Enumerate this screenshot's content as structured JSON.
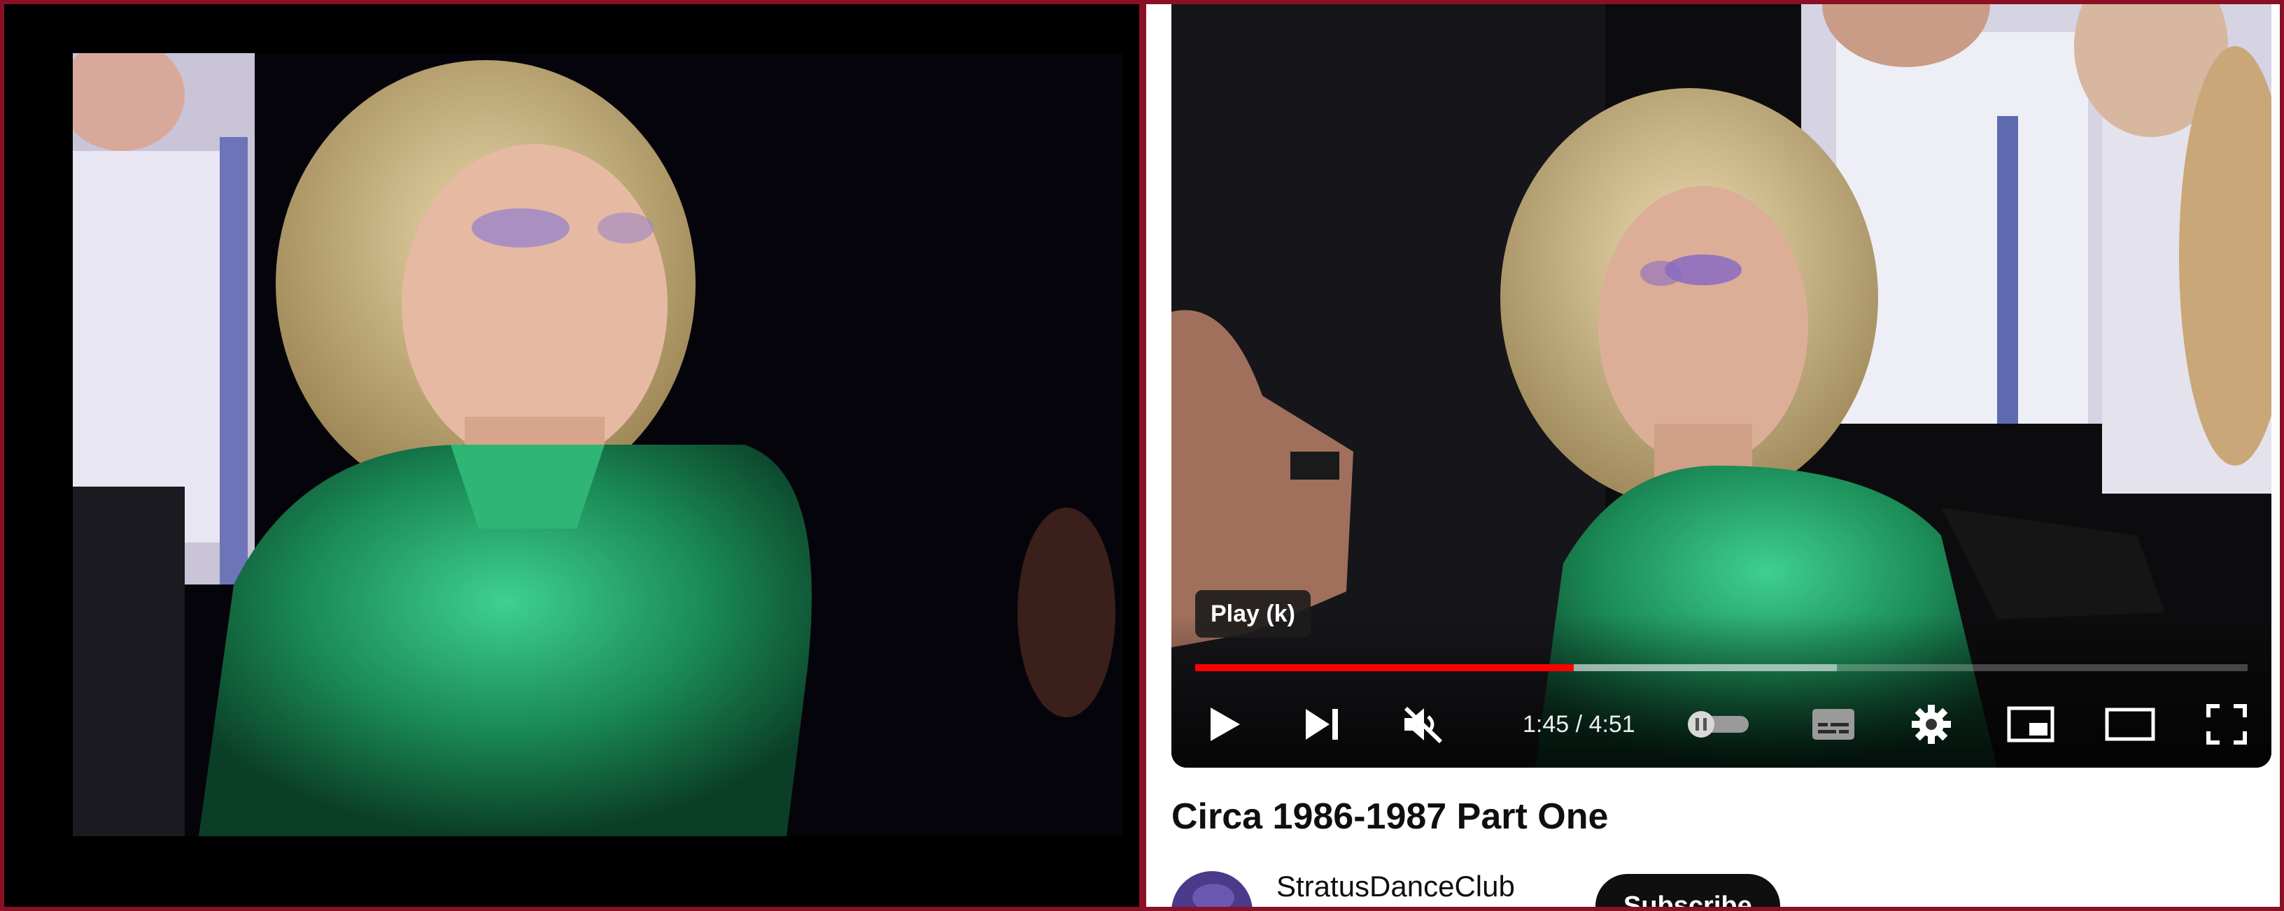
{
  "player": {
    "tooltip": "Play (k)",
    "time_current": "1:45",
    "time_separator": " / ",
    "time_total": "4:51",
    "progress_played": 0.36,
    "progress_buffered": 0.61,
    "accent_color": "#ff0000",
    "icons": [
      "play-icon",
      "next-icon",
      "volume-muted-icon",
      "autoplay-toggle-icon",
      "subtitles-icon",
      "settings-icon",
      "miniplayer-icon",
      "theater-mode-icon",
      "fullscreen-icon"
    ]
  },
  "video": {
    "title": "Circa 1986-1987 Part One"
  },
  "channel": {
    "name": "StratusDanceClub",
    "subscribe_label": "Subscribe"
  }
}
